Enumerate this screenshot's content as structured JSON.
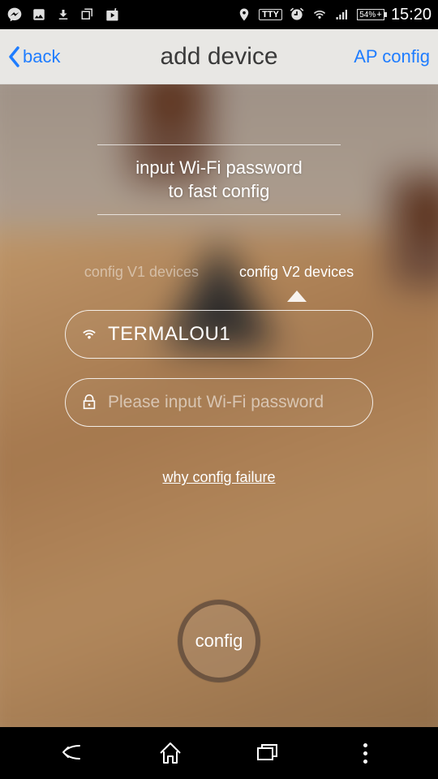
{
  "status_bar": {
    "battery_text": "54%",
    "time": "15:20"
  },
  "header": {
    "back_label": "back",
    "title": "add device",
    "ap_link": "AP config"
  },
  "instruction": {
    "line1": "input Wi-Fi password",
    "line2": "to fast config"
  },
  "tabs": {
    "v1": "config V1 devices",
    "v2": "config V2 devices"
  },
  "wifi": {
    "ssid": "TERMALOU1",
    "password_placeholder": "Please input Wi-Fi password",
    "password_value": ""
  },
  "help_link": "why config failure",
  "config_button": "config"
}
